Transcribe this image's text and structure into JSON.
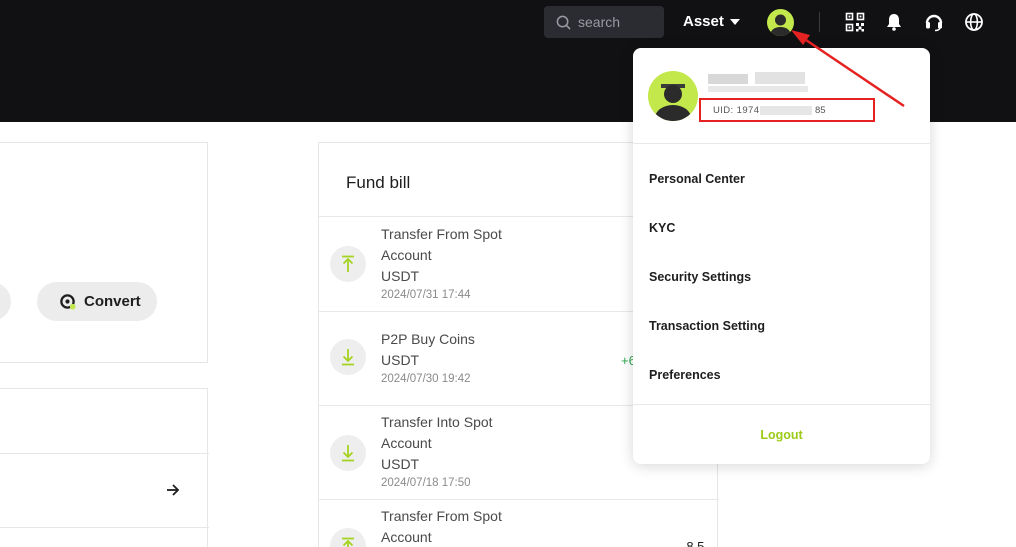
{
  "header": {
    "search_placeholder": "search",
    "asset_label": "Asset",
    "icons": [
      "search-icon",
      "caret-down-icon",
      "user-avatar-icon",
      "qr-code-icon",
      "bell-icon",
      "headset-icon",
      "globe-icon"
    ]
  },
  "actions": {
    "convert_label": "Convert"
  },
  "fund_bill": {
    "title": "Fund bill",
    "items": [
      {
        "lines": [
          "Transfer From Spot",
          "Account",
          "USDT"
        ],
        "date": "2024/07/31 17:44",
        "direction": "out",
        "amount": ""
      },
      {
        "lines": [
          "P2P Buy Coins",
          "USDT"
        ],
        "date": "2024/07/30 19:42",
        "direction": "in",
        "amount": "+6"
      },
      {
        "lines": [
          "Transfer Into Spot",
          "Account",
          "USDT"
        ],
        "date": "2024/07/18 17:50",
        "direction": "in",
        "amount": ""
      },
      {
        "lines": [
          "Transfer From Spot",
          "Account"
        ],
        "date": "",
        "direction": "out",
        "amount": "-8.5"
      }
    ]
  },
  "user_menu": {
    "uid_prefix": "UID: 1974",
    "uid_suffix": "85",
    "items": [
      "Personal Center",
      "KYC",
      "Security Settings",
      "Transaction Setting",
      "Preferences"
    ],
    "logout_label": "Logout"
  },
  "colors": {
    "header_bg": "#111114",
    "accent_green": "#c3e84c",
    "logout_green": "#9ccb17",
    "positive_amount": "#2ea44f",
    "annotation_red": "#e52222"
  }
}
